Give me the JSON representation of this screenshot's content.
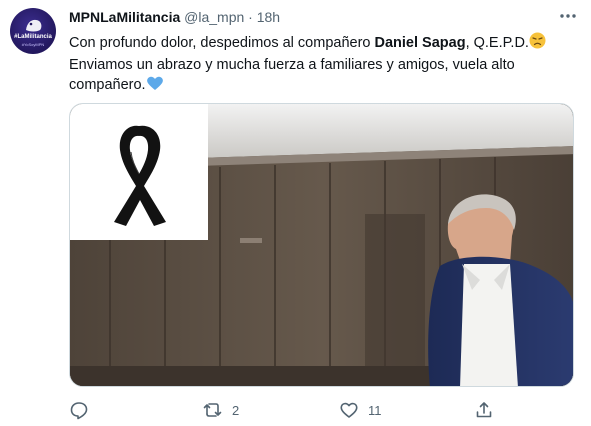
{
  "tweet": {
    "display_name": "MPNLaMilitancia",
    "handle": "@la_mpn",
    "separator": "·",
    "time": "18h",
    "text_line1_pre": "Con profundo dolor, despedimos al compañero ",
    "text_line1_bold": "Daniel Sapag",
    "text_line1_post": ", Q.E.P.D.",
    "text_line2": "Enviamos un abrazo y mucha fuerza a familiares y amigos, vuela alto",
    "text_line3": "compañero.",
    "avatar_text": "#LaMilitancia",
    "avatar_subtext": "#YoSoyMPN"
  },
  "actions": {
    "reply_count": "",
    "retweet_count": "2",
    "like_count": "11"
  },
  "icons": {
    "more": "more-icon",
    "reply": "reply-icon",
    "retweet": "retweet-icon",
    "like": "heart-icon",
    "share": "share-icon",
    "sad_emoji": "sad-face-emoji",
    "heart_emoji": "blue-heart-emoji"
  },
  "colors": {
    "text": "#0f1419",
    "secondary": "#536471",
    "border": "#cfd9de",
    "blue_heart": "#5da9e9",
    "emoji_yellow": "#f7c23b"
  }
}
